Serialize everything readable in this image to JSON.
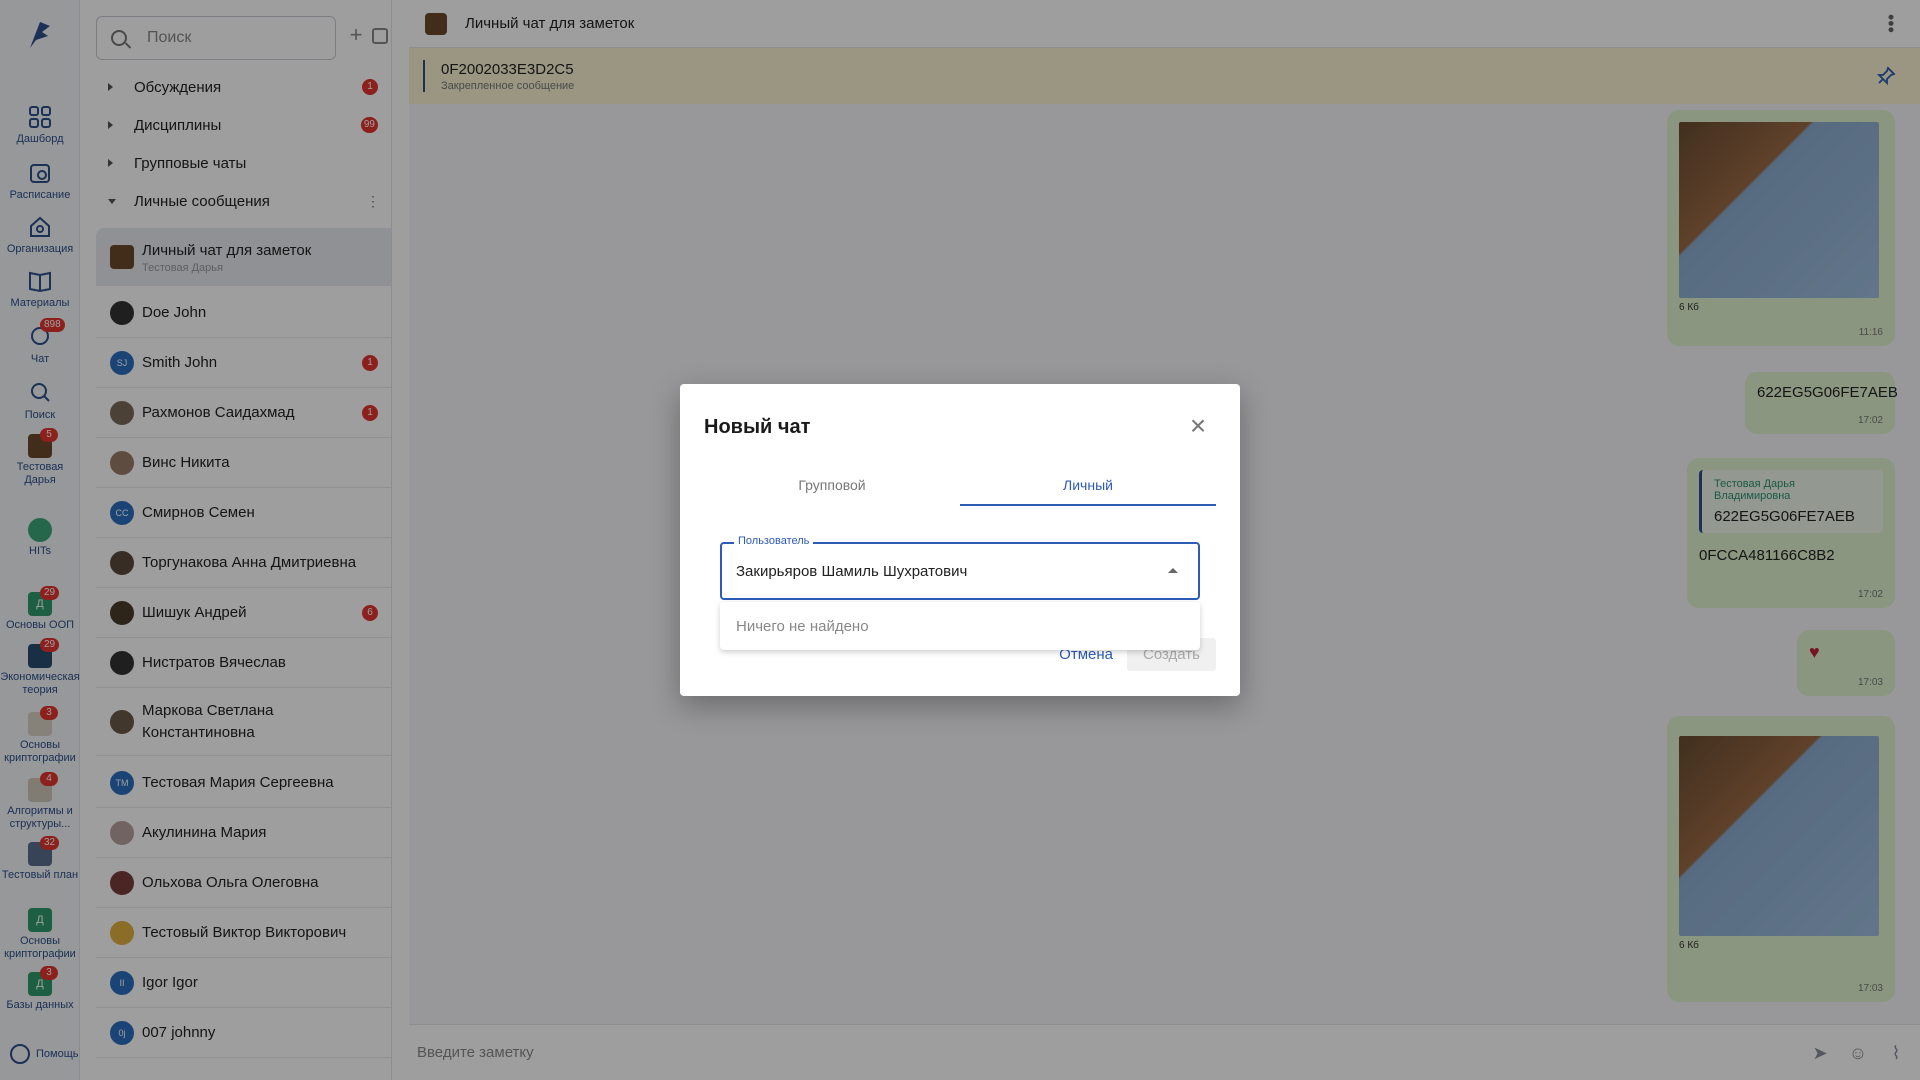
{
  "rail": {
    "items": [
      {
        "label": "Дашборд",
        "icon": "dashboard-icon"
      },
      {
        "label": "Расписание",
        "icon": "calendar-icon"
      },
      {
        "label": "Организация",
        "icon": "organization-icon"
      },
      {
        "label": "Материалы",
        "icon": "book-icon"
      },
      {
        "label": "Чат",
        "icon": "chat-icon",
        "badge": "898"
      },
      {
        "label": "Поиск",
        "icon": "search-icon"
      },
      {
        "label": "Тестовая Дарья",
        "icon": "profile-avatar",
        "badge": "5"
      },
      {
        "label": "HITs",
        "icon": "hits-icon"
      },
      {
        "label": "Основы ООП",
        "icon": "course-tile",
        "badge": "29"
      },
      {
        "label": "Экономическая теория",
        "icon": "course-tile",
        "badge": "29"
      },
      {
        "label": "Основы криптографии",
        "icon": "course-tile",
        "badge": "3"
      },
      {
        "label": "Алгоритмы и структуры...",
        "icon": "course-tile",
        "badge": "4"
      },
      {
        "label": "Тестовый план",
        "icon": "course-tile",
        "badge": "32"
      },
      {
        "label": "Основы криптографии",
        "icon": "course-tile"
      },
      {
        "label": "Базы данных",
        "icon": "course-tile",
        "badge": "3"
      }
    ],
    "help_label": "Помощь"
  },
  "list": {
    "search_placeholder": "Поиск",
    "sections": [
      {
        "label": "Обсуждения",
        "badge": "1"
      },
      {
        "label": "Дисциплины",
        "badge": "99"
      },
      {
        "label": "Групповые чаты"
      },
      {
        "label": "Личные сообщения"
      }
    ],
    "chats": [
      {
        "name": "Личный чат для заметок",
        "sub": "Тестовая Дарья",
        "initials": ""
      },
      {
        "name": "Doe John",
        "initials": ""
      },
      {
        "name": "Smith John",
        "initials": "SJ",
        "badge": "1"
      },
      {
        "name": "Рахмонов Саидахмад",
        "initials": "",
        "badge": "1"
      },
      {
        "name": "Винс Никита",
        "initials": ""
      },
      {
        "name": "Смирнов Семен",
        "initials": "СС"
      },
      {
        "name": "Торгунакова Анна Дмитриевна",
        "initials": ""
      },
      {
        "name": "Шишук Андрей",
        "initials": "",
        "badge": "6"
      },
      {
        "name": "Нистратов Вячеслав",
        "initials": ""
      },
      {
        "name": "Маркова Светлана Константиновна",
        "initials": ""
      },
      {
        "name": "Тестовая Мария Сергеевна",
        "initials": "ТМ"
      },
      {
        "name": "Акулинина Мария",
        "initials": ""
      },
      {
        "name": "Ольхова Ольга Олеговна",
        "initials": ""
      },
      {
        "name": "Тестовый Виктор Викторович",
        "initials": ""
      },
      {
        "name": "Igor Igor",
        "initials": "II"
      },
      {
        "name": "007 johnny",
        "initials": "0j"
      }
    ]
  },
  "main": {
    "title": "Личный чат для заметок",
    "pinned": {
      "text": "0F2002033E3D2C5",
      "sub": "Закрепленное сообщение"
    },
    "messages": {
      "m1": {
        "size": "6 Кб",
        "time": "11:16"
      },
      "m2": {
        "text": "622EG5G06FE7AEB",
        "time": "17:02"
      },
      "m3": {
        "quote_author": "Тестовая Дарья Владимировна",
        "quote_text": "622EG5G06FE7AEB",
        "text": "0FCCA481166C8B2",
        "time": "17:02"
      },
      "m4": {
        "text": "♥",
        "time": "17:03"
      },
      "m5": {
        "size": "6 Кб",
        "time": "17:03"
      }
    },
    "composer_placeholder": "Введите заметку"
  },
  "dialog": {
    "title": "Новый чат",
    "tabs": [
      "Групповой",
      "Личный"
    ],
    "field_label": "Пользователь",
    "field_value": "Закирьяров Шамиль Шухратович",
    "no_results": "Ничего не найдено",
    "cancel": "Отмена",
    "create": "Создать"
  },
  "colors": {
    "accent": "#2d5bb8",
    "badge": "#e3342f",
    "bubble": "#dff3cf",
    "pinned_bg": "#f9f3d0"
  }
}
